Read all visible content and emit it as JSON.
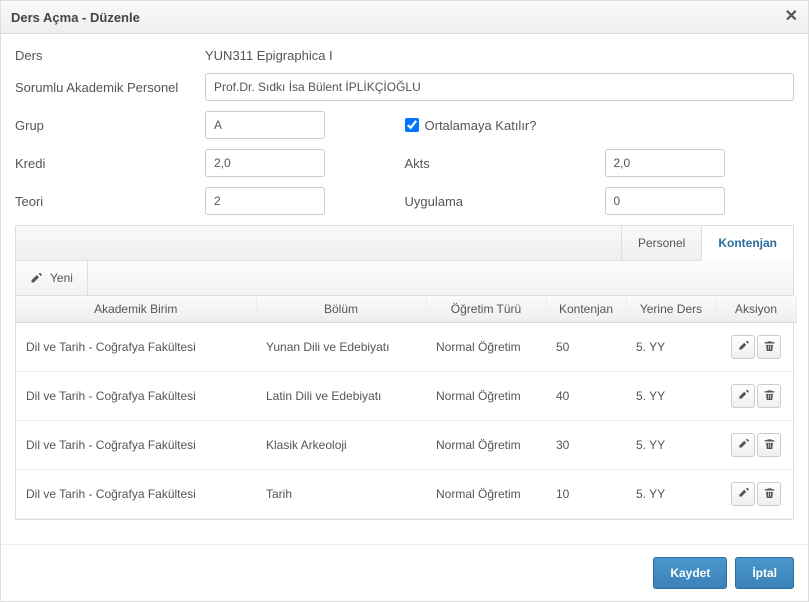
{
  "header": {
    "title": "Ders Açma - Düzenle"
  },
  "form": {
    "ders_label": "Ders",
    "ders_value": "YUN311 Epigraphica I",
    "sorumlu_label": "Sorumlu Akademik Personel",
    "sorumlu_value": "Prof.Dr. Sıdkı İsa Bülent İPLİKÇİOĞLU",
    "grup_label": "Grup",
    "grup_value": "A",
    "ortalama_label": "Ortalamaya Katılır?",
    "ortalama_checked": true,
    "kredi_label": "Kredi",
    "kredi_value": "2,0",
    "akts_label": "Akts",
    "akts_value": "2,0",
    "teori_label": "Teori",
    "teori_value": "2",
    "uygulama_label": "Uygulama",
    "uygulama_value": "0"
  },
  "tabs": {
    "personel": "Personel",
    "kontenjan": "Kontenjan"
  },
  "toolbar": {
    "yeni": "Yeni"
  },
  "table": {
    "headers": {
      "akademik_birim": "Akademik Birim",
      "bolum": "Bölüm",
      "ogretim_turu": "Öğretim Türü",
      "kontenjan": "Kontenjan",
      "yerine_ders": "Yerine Ders",
      "aksiyon": "Aksiyon"
    },
    "rows": [
      {
        "akademik_birim": "Dil ve Tarih - Coğrafya Fakültesi",
        "bolum": "Yunan Dili ve Edebiyatı",
        "ogretim_turu": "Normal Öğretim",
        "kontenjan": "50",
        "yerine_ders": "5. YY"
      },
      {
        "akademik_birim": "Dil ve Tarih - Coğrafya Fakültesi",
        "bolum": "Latin Dili ve Edebiyatı",
        "ogretim_turu": "Normal Öğretim",
        "kontenjan": "40",
        "yerine_ders": "5. YY"
      },
      {
        "akademik_birim": "Dil ve Tarih - Coğrafya Fakültesi",
        "bolum": "Klasik Arkeoloji",
        "ogretim_turu": "Normal Öğretim",
        "kontenjan": "30",
        "yerine_ders": "5. YY"
      },
      {
        "akademik_birim": "Dil ve Tarih - Coğrafya Fakültesi",
        "bolum": "Tarih",
        "ogretim_turu": "Normal Öğretim",
        "kontenjan": "10",
        "yerine_ders": "5. YY"
      }
    ]
  },
  "footer": {
    "kaydet": "Kaydet",
    "iptal": "İptal"
  }
}
